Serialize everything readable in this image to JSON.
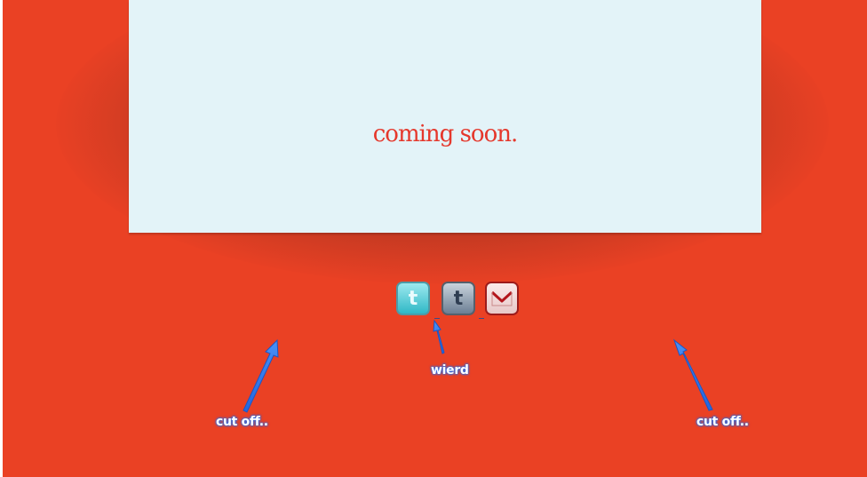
{
  "page": {
    "headline": "coming soon."
  },
  "social": {
    "twitter_glyph": "t",
    "tumblr_glyph": "t",
    "mail_icon": "mail-envelope-icon"
  },
  "annotations": {
    "left": "cut off..",
    "middle": "wierd",
    "right": "cut off.."
  },
  "colors": {
    "background": "#ea4124",
    "panel": "#e3f3f8",
    "headline": "#e5382c",
    "annotation": "#2a6fe8"
  }
}
